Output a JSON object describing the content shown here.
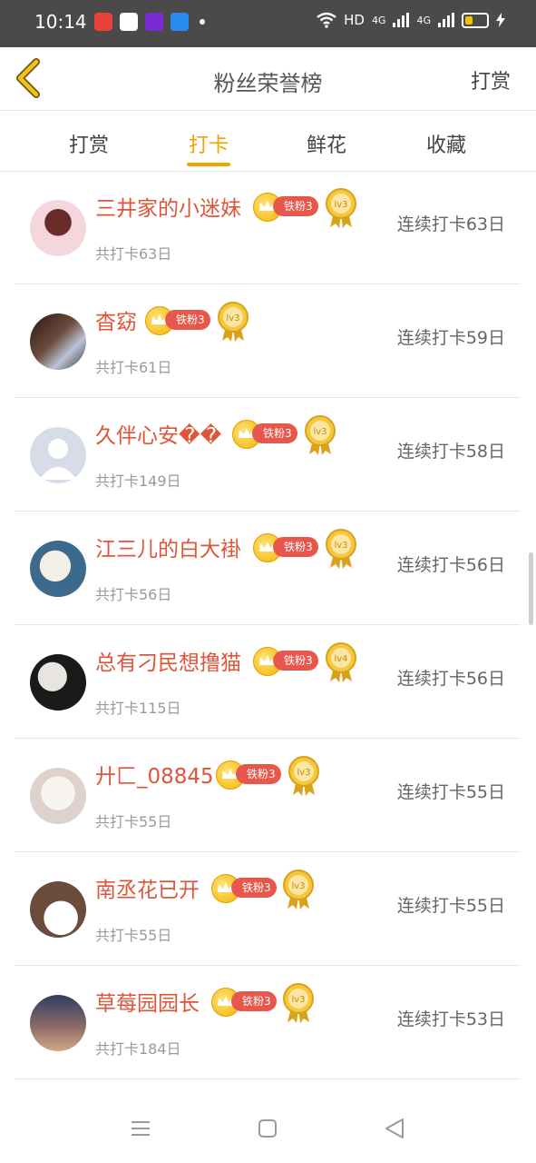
{
  "status_bar": {
    "time": "10:14",
    "network": "HD",
    "signal1": "4G",
    "signal2": "4G"
  },
  "header": {
    "title": "粉丝荣誉榜",
    "right_action": "打赏"
  },
  "tabs": [
    {
      "label": "打赏",
      "active": false
    },
    {
      "label": "打卡",
      "active": true
    },
    {
      "label": "鲜花",
      "active": false
    },
    {
      "label": "收藏",
      "active": false
    }
  ],
  "fans": [
    {
      "name": "三井家的小迷妹",
      "fan_level": "铁粉3",
      "medal": "lv3",
      "total": "共打卡63日",
      "streak": "连续打卡63日"
    },
    {
      "name": "杳窈",
      "fan_level": "铁粉3",
      "medal": "lv3",
      "total": "共打卡61日",
      "streak": "连续打卡59日"
    },
    {
      "name": "久伴心安��",
      "fan_level": "铁粉3",
      "medal": "lv3",
      "total": "共打卡149日",
      "streak": "连续打卡58日"
    },
    {
      "name": "江三儿的白大褂",
      "fan_level": "铁粉3",
      "medal": "lv3",
      "total": "共打卡56日",
      "streak": "连续打卡56日"
    },
    {
      "name": "总有刁民想撸猫",
      "fan_level": "铁粉3",
      "medal": "lv4",
      "total": "共打卡115日",
      "streak": "连续打卡56日"
    },
    {
      "name": "廾匚_08845",
      "fan_level": "铁粉3",
      "medal": "lv3",
      "total": "共打卡55日",
      "streak": "连续打卡55日"
    },
    {
      "name": "南丞花已开",
      "fan_level": "铁粉3",
      "medal": "lv3",
      "total": "共打卡55日",
      "streak": "连续打卡55日"
    },
    {
      "name": "草莓园园长",
      "fan_level": "铁粉3",
      "medal": "lv3",
      "total": "共打卡184日",
      "streak": "连续打卡53日"
    }
  ],
  "colors": {
    "accent": "#f0a400",
    "name": "#e0553a",
    "pill": "#e8574b"
  }
}
